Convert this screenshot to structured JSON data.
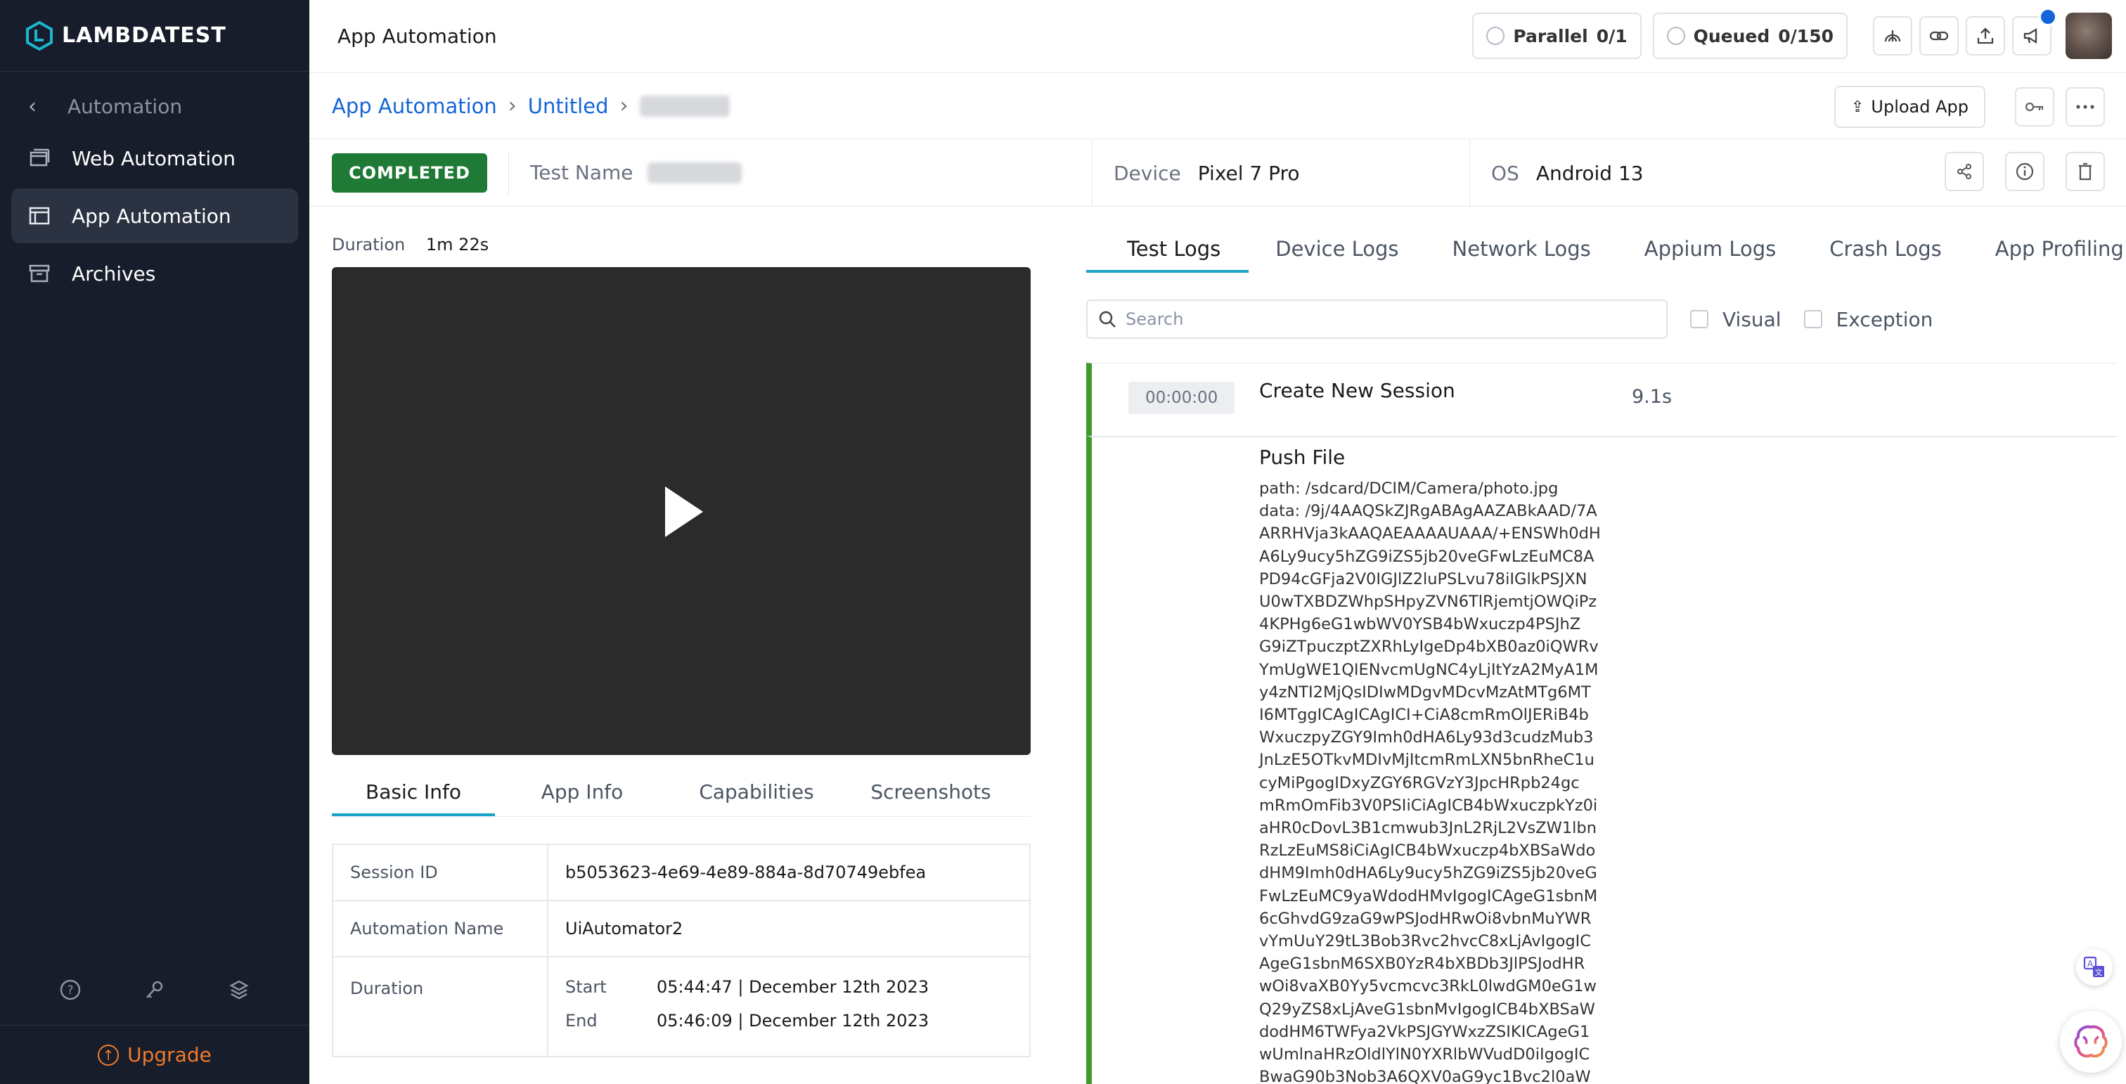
{
  "brand": {
    "name": "LAMBDATEST"
  },
  "sidebar": {
    "back_label": "Automation",
    "items": [
      {
        "label": "Web Automation",
        "icon": "web-automation-icon"
      },
      {
        "label": "App Automation",
        "icon": "app-automation-icon",
        "active": true
      },
      {
        "label": "Archives",
        "icon": "archive-icon"
      }
    ],
    "tools": [
      "help-icon",
      "key-icon",
      "layers-icon"
    ],
    "upgrade_label": "Upgrade"
  },
  "topbar": {
    "title": "App Automation",
    "parallel_label": "Parallel",
    "parallel_count": "0/1",
    "queued_label": "Queued",
    "queued_count": "0/150",
    "icons": [
      "tunnel-icon",
      "link-icon",
      "upload-icon",
      "megaphone-icon"
    ]
  },
  "breadcrumb": {
    "items": [
      "App Automation",
      "Untitled"
    ],
    "upload_label": "Upload App"
  },
  "status": {
    "badge": "COMPLETED",
    "test_name_label": "Test Name",
    "device_label": "Device",
    "device_value": "Pixel 7 Pro",
    "os_label": "OS",
    "os_value": "Android 13"
  },
  "left": {
    "duration_label": "Duration",
    "duration_value": "1m 22s",
    "tabs": [
      "Basic Info",
      "App Info",
      "Capabilities",
      "Screenshots"
    ],
    "info": {
      "session_id_label": "Session ID",
      "session_id_value": "b5053623-4e69-4e89-884a-8d70749ebfea",
      "automation_name_label": "Automation Name",
      "automation_name_value": "UiAutomator2",
      "duration_label": "Duration",
      "start_label": "Start",
      "start_value": "05:44:47 | December 12th 2023",
      "end_label": "End",
      "end_value": "05:46:09 | December 12th 2023"
    }
  },
  "right": {
    "tabs": [
      "Test Logs",
      "Device Logs",
      "Network Logs",
      "Appium Logs",
      "Crash Logs",
      "App Profiling"
    ],
    "search_placeholder": "Search",
    "filter_visual": "Visual",
    "filter_exception": "Exception",
    "logs": [
      {
        "time": "00:00:00",
        "title": "Create New Session",
        "duration": "9.1s"
      },
      {
        "title": "Push File",
        "path": "path: /sdcard/DCIM/Camera/photo.jpg",
        "data_lines": [
          "data: /9j/4AAQSkZJRgABAgAAZABkAAD/7A",
          "ARRHVja3kAAQAEAAAAUAAA/+ENSWh0dH",
          "A6Ly9ucy5hZG9iZS5jb20veGFwLzEuMC8A",
          "PD94cGFja2V0IGJlZ2luPSLvu78iIGlkPSJXN",
          "U0wTXBDZWhpSHpyZVN6TlRjemtjOWQiPz",
          "4KPHg6eG1wbWV0YSB4bWxuczp4PSJhZ",
          "G9iZTpuczptZXRhLyIgeDp4bXB0az0iQWRv",
          "YmUgWE1QIENvcmUgNC4yLjItYzA2MyA1M",
          "y4zNTI2MjQsIDIwMDgvMDcvMzAtMTg6MT",
          "I6MTggICAgICAgICI+CiA8cmRmOlJERiB4b",
          "WxuczpyZGY9Imh0dHA6Ly93d3cudzMub3",
          "JnLzE5OTkvMDIvMjItcmRmLXN5bnRheC1u",
          "cyMiPgogIDxyZGY6RGVzY3JpcHRpb24gc",
          "mRmOmFib3V0PSIiCiAgICB4bWxuczpkYz0i",
          "aHR0cDovL3B1cmwub3JnL2RjL2VsZW1lbn",
          "RzLzEuMS8iCiAgICB4bWxuczp4bXBSaWdo",
          "dHM9Imh0dHA6Ly9ucy5hZG9iZS5jb20veG",
          "FwLzEuMC9yaWdodHMvIgogICAgeG1sbnM",
          "6cGhvdG9zaG9wPSJodHRwOi8vbnMuYWR",
          "vYmUuY29tL3Bob3Rvc2hvcC8xLjAvIgogIC",
          "AgeG1sbnM6SXB0YzR4bXBDb3JlPSJodHR",
          "wOi8vaXB0Yy5vcmcvc3RkL0lwdGM0eG1w",
          "Q29yZS8xLjAveG1sbnMvIgogICB4bXBSaW",
          "dodHM6TWFya2VkPSJGYWxzZSIKICAgeG1",
          "wUmlnaHRzOldlYlN0YXRlbWVudD0iIgogIC",
          "BwaG90b3Nob3A6QXV0aG9yc1Bvc2l0aW"
        ]
      }
    ]
  }
}
